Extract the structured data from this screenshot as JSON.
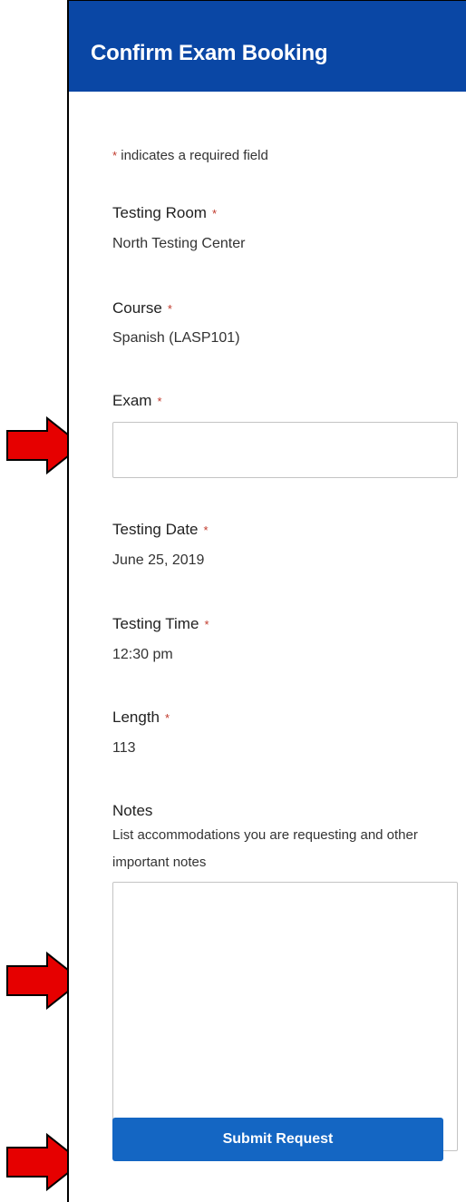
{
  "header": {
    "title": "Confirm Exam Booking"
  },
  "required_note": {
    "asterisk": "*",
    "text": " indicates a required field"
  },
  "fields": {
    "testing_room": {
      "label": "Testing Room",
      "value": "North Testing Center"
    },
    "course": {
      "label": "Course",
      "value": "Spanish (LASP101)"
    },
    "exam": {
      "label": "Exam",
      "value": ""
    },
    "testing_date": {
      "label": "Testing Date",
      "value": "June 25, 2019"
    },
    "testing_time": {
      "label": "Testing Time",
      "value": "12:30 pm"
    },
    "length": {
      "label": "Length",
      "value": "113"
    },
    "notes": {
      "label": "Notes",
      "help": "List accommodations you are requesting and other important notes",
      "value": ""
    }
  },
  "asterisk": "*",
  "submit": {
    "label": "Submit Request"
  },
  "colors": {
    "header_bg": "#0a47a5",
    "button_bg": "#1466c3",
    "arrow_fill": "#e60000",
    "required_asterisk": "#c0392b"
  }
}
